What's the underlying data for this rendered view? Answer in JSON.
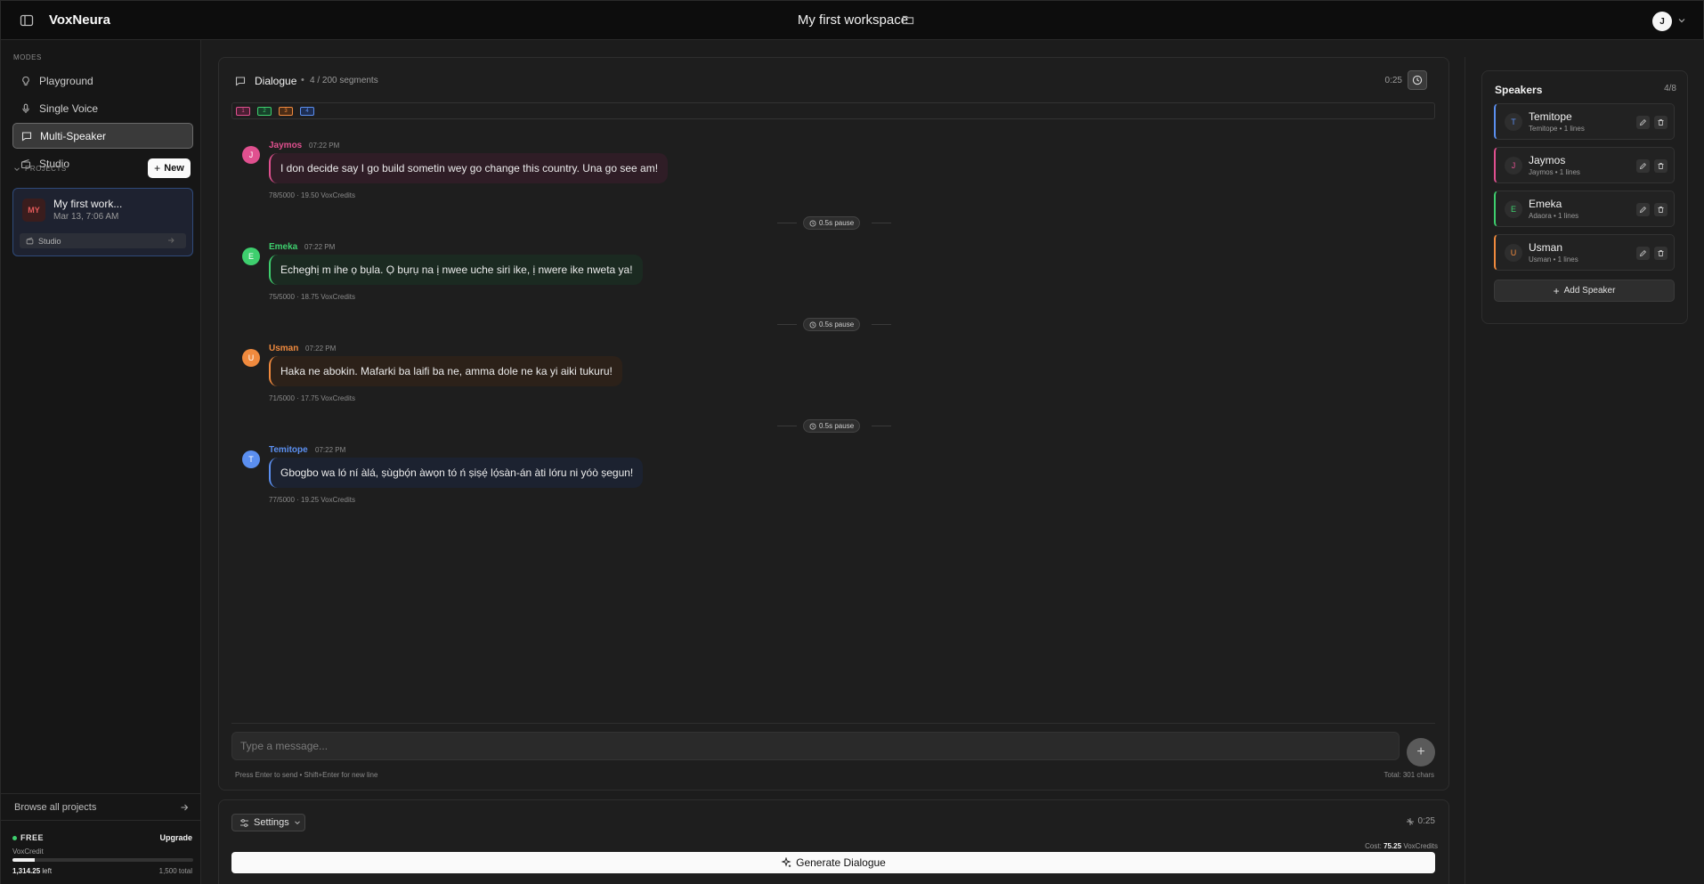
{
  "app": {
    "brand": "VoxNeura",
    "workspace_title": "My first workspace",
    "user_initial": "J"
  },
  "sidebar": {
    "modes_label": "MODES",
    "modes": [
      {
        "label": "Playground",
        "icon": "lightbulb-icon",
        "active": false
      },
      {
        "label": "Single Voice",
        "icon": "microphone-icon",
        "active": false
      },
      {
        "label": "Multi-Speaker",
        "icon": "chat-bubble-icon",
        "active": true
      },
      {
        "label": "Studio",
        "icon": "clapperboard-icon",
        "active": false
      }
    ],
    "projects_label": "PROJECTS",
    "new_label": "New",
    "project": {
      "badge": "MY",
      "name": "My first work...",
      "date": "Mar 13, 7:06 AM",
      "mode": "Studio"
    },
    "browse_label": "Browse all projects",
    "plan": {
      "tier": "FREE",
      "upgrade_label": "Upgrade",
      "credit_label": "VoxCredit",
      "left_value": "1,314.25",
      "left_suffix": " left",
      "total": "1,500 total",
      "used_fraction": 0.124
    }
  },
  "dialogue": {
    "title": "Dialogue",
    "separator": "•",
    "segments": "4 / 200 segments",
    "duration": "0:25",
    "chips": [
      {
        "label": "1",
        "color": "#e0508f",
        "bg": "#4a1f33"
      },
      {
        "label": "2",
        "color": "#3ecf6e",
        "bg": "#17402a"
      },
      {
        "label": "3",
        "color": "#f08a3e",
        "bg": "#4a2c16"
      },
      {
        "label": "4",
        "color": "#5b8ff0",
        "bg": "#1e2e52"
      }
    ],
    "messages": [
      {
        "initial": "J",
        "name": "Jaymos",
        "time": "07:22 PM",
        "text": "I don decide say I go build sometin wey go change this country. Una go see am!",
        "meta": "78/5000 · 19.50 VoxCredits",
        "color": "#e0508f",
        "bubble_bg": "#2f1d26"
      },
      {
        "initial": "E",
        "name": "Emeka",
        "time": "07:22 PM",
        "text": "Echeghị m ihe ọ bụla. Ọ bụrụ na ị nwee uche siri ike, ị nwere ike nweta ya!",
        "meta": "75/5000 · 18.75 VoxCredits",
        "color": "#3ecf6e",
        "bubble_bg": "#1b2a21"
      },
      {
        "initial": "U",
        "name": "Usman",
        "time": "07:22 PM",
        "text": "Haka ne abokin. Mafarki ba laifi ba ne, amma dole ne ka yi aiki tukuru!",
        "meta": "71/5000 · 17.75 VoxCredits",
        "color": "#f08a3e",
        "bubble_bg": "#2c2119"
      },
      {
        "initial": "T",
        "name": "Temitope",
        "time": "07:22 PM",
        "text": "Gbogbo wa ló ní àlá, ṣùgbọ́n àwọn tó ń ṣiṣẹ́ lọ́sàn-án àti lóru ni yóò ṣegun!",
        "meta": "77/5000 · 19.25 VoxCredits",
        "color": "#5b8ff0",
        "bubble_bg": "#1c2230"
      }
    ],
    "pause_label": "0.5s pause",
    "input_placeholder": "Type a message...",
    "hint": "Press Enter to send • Shift+Enter for new line",
    "total_chars": "Total: 301 chars"
  },
  "controls": {
    "settings_label": "Settings",
    "duration": "0:25",
    "cost_prefix": "Cost: ",
    "cost_value": "75.25",
    "cost_suffix": " VoxCredits",
    "generate_label": "Generate Dialogue"
  },
  "speakers": {
    "title": "Speakers",
    "count": "4/8",
    "list": [
      {
        "initial": "T",
        "name": "Temitope",
        "sub": "Temitope • 1 lines",
        "color": "#5b8ff0"
      },
      {
        "initial": "J",
        "name": "Jaymos",
        "sub": "Jaymos • 1 lines",
        "color": "#e0508f"
      },
      {
        "initial": "E",
        "name": "Emeka",
        "sub": "Adaora • 1 lines",
        "color": "#3ecf6e"
      },
      {
        "initial": "U",
        "name": "Usman",
        "sub": "Usman • 1 lines",
        "color": "#f08a3e"
      }
    ],
    "add_label": "Add Speaker"
  }
}
